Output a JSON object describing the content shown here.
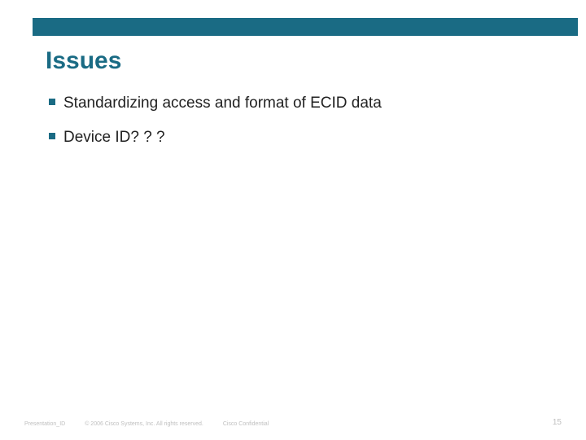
{
  "slide": {
    "title": "Issues",
    "bullets": [
      "Standardizing access and format of ECID data",
      "Device ID? ? ?"
    ]
  },
  "footer": {
    "presentation_id": "Presentation_ID",
    "copyright": "© 2006 Cisco Systems, Inc. All rights reserved.",
    "confidential": "Cisco Confidential",
    "page": "15"
  },
  "colors": {
    "accent": "#1a6b84",
    "text": "#222222",
    "footer_text": "#bfbfbf"
  }
}
